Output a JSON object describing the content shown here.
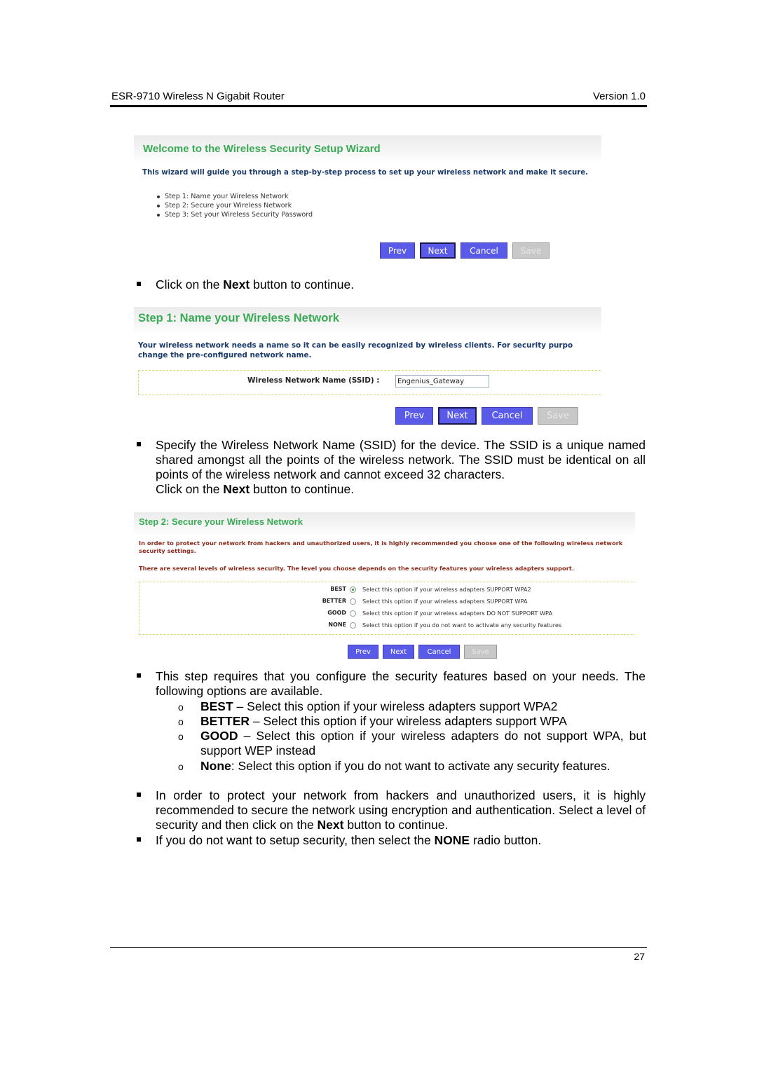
{
  "header": {
    "product": "ESR-9710 Wireless N Gigabit Router",
    "version": "Version 1.0"
  },
  "buttons": {
    "prev": "Prev",
    "next": "Next",
    "cancel": "Cancel",
    "save": "Save"
  },
  "wizard_welcome": {
    "title": "Welcome to the Wireless Security Setup Wizard",
    "description": "This wizard will guide you through a step-by-step process to set up your wireless network and make it secure.",
    "steps": [
      "Step 1: Name your Wireless Network",
      "Step 2: Secure your Wireless Network",
      "Step 3: Set your Wireless Security Password"
    ]
  },
  "instruction_1": {
    "pre": "Click on the ",
    "bold": "Next",
    "post": " button to continue."
  },
  "step1": {
    "title": "Step 1: Name your Wireless Network",
    "description_line1": "Your wireless network needs a name so it can be easily recognized by wireless clients. For security purpo",
    "description_line2": "change the pre-configured network name.",
    "ssid_label": "Wireless Network Name (SSID) :",
    "ssid_value": "Engenius_Gateway"
  },
  "instruction_2": {
    "text": "Specify the Wireless Network Name (SSID) for the device. The SSID is a unique named shared amongst all the points of the wireless network. The SSID must be identical on all points of the wireless network and cannot exceed 32 characters.",
    "pre": "Click on the ",
    "bold": "Next",
    "post": " button to continue."
  },
  "step2": {
    "title": "Step 2: Secure your Wireless Network",
    "description1": "In order to protect your network from hackers and unauthorized users, it is highly recommended you choose one of the following wireless network security settings.",
    "description2": "There are several levels of wireless security. The level you choose depends on the security features your wireless adapters support.",
    "options": [
      {
        "label": "BEST",
        "text": "Select this option if your wireless adapters SUPPORT WPA2",
        "selected": true
      },
      {
        "label": "BETTER",
        "text": "Select this option if your wireless adapters SUPPORT WPA",
        "selected": false
      },
      {
        "label": "GOOD",
        "text": "Select this option if your wireless adapters DO NOT SUPPORT WPA",
        "selected": false
      },
      {
        "label": "NONE",
        "text": "Select this option if you do not want to activate any security features",
        "selected": false
      }
    ]
  },
  "instruction_3": {
    "intro": "This step requires that you configure the security features based on your needs. The following options are available.",
    "sub_items": [
      {
        "bold": "BEST",
        "text": " – Select this option if your wireless adapters support WPA2"
      },
      {
        "bold": "BETTER",
        "text": " – Select this option if your wireless adapters support WPA"
      },
      {
        "bold": "GOOD",
        "text": " – Select this option if your wireless adapters do not support WPA, but support WEP instead"
      },
      {
        "bold": "None",
        "text": ": Select this option if you do not want to activate any security features."
      }
    ]
  },
  "instruction_4": {
    "pre": "In order to protect your network from hackers and unauthorized users, it is highly recommended to secure the network using encryption and authentication. Select a level of security and then click on the ",
    "bold": "Next",
    "post": " button to continue."
  },
  "instruction_5": {
    "pre": "If you do not want to setup security, then select the ",
    "bold": "NONE",
    "post": " radio button."
  },
  "page_number": "27"
}
